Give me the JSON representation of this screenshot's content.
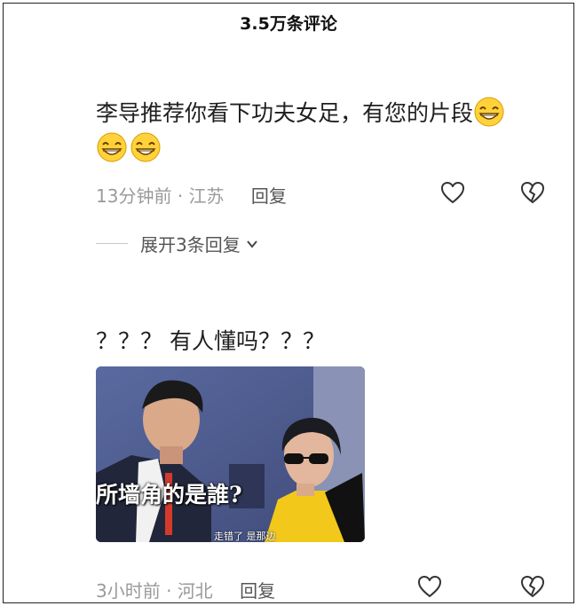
{
  "header": {
    "title": "3.5万条评论"
  },
  "comments": [
    {
      "text": "李导推荐你看下功夫女足，有您的片段",
      "time": "13分钟前",
      "separator": "·",
      "location": "江苏",
      "reply_label": "回复",
      "expand_label": "展开3条回复",
      "emoji_name": "grinning-face-emoji"
    },
    {
      "text": "？？？ 有人懂吗？？？",
      "time": "3小时前",
      "separator": "·",
      "location": "河北",
      "reply_label": "回复",
      "meme": {
        "caption": "所墙角的是誰?",
        "subtitle": "走错了  是那边"
      }
    }
  ],
  "icons": {
    "like": "heart-icon",
    "dislike": "broken-heart-icon",
    "expand": "chevron-down-icon"
  }
}
